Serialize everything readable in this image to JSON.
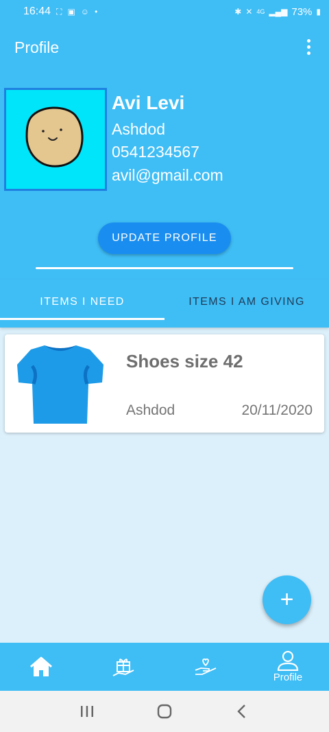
{
  "status_bar": {
    "time": "16:44",
    "network": "4G",
    "battery": "73%"
  },
  "header": {
    "title": "Profile"
  },
  "user": {
    "name": "Avi Levi",
    "city": "Ashdod",
    "phone": "0541234567",
    "email": "avil@gmail.com"
  },
  "update_button_label": "UPDATE PROFILE",
  "tabs": [
    {
      "label": "ITEMS I NEED",
      "selected": true
    },
    {
      "label": "ITEMS I AM GIVING",
      "selected": false
    }
  ],
  "items": [
    {
      "title": "Shoes size 42",
      "city": "Ashdod",
      "date": "20/11/2020",
      "image_icon": "tshirt-icon"
    }
  ],
  "fab_symbol": "+",
  "bottom_nav": [
    {
      "icon": "home-icon",
      "label": ""
    },
    {
      "icon": "gift-hand-icon",
      "label": ""
    },
    {
      "icon": "heart-hand-icon",
      "label": ""
    },
    {
      "icon": "person-icon",
      "label": "Profile"
    }
  ],
  "colors": {
    "primary": "#3fbdf5",
    "button": "#1a8ef0",
    "content_background": "#dcf0fb",
    "avatar_background": "#00e5fa",
    "avatar_border": "#1f80e0"
  }
}
